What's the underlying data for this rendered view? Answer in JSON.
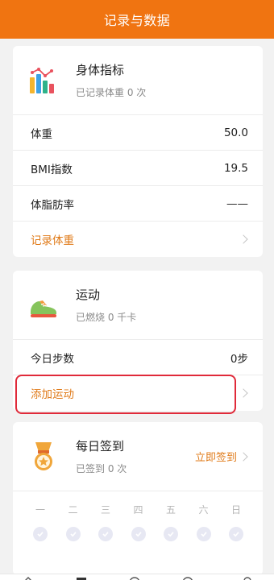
{
  "header": {
    "title": "记录与数据"
  },
  "body_card": {
    "title": "身体指标",
    "subtitle": "已记录体重 0 次",
    "rows": [
      {
        "label": "体重",
        "value": "50.0"
      },
      {
        "label": "BMI指数",
        "value": "19.5"
      },
      {
        "label": "体脂肪率",
        "value": "——"
      }
    ],
    "action_label": "记录体重"
  },
  "exercise_card": {
    "title": "运动",
    "subtitle": "已燃烧 0 千卡",
    "steps_label": "今日步数",
    "steps_value": "0步",
    "action_label": "添加运动"
  },
  "checkin_card": {
    "title": "每日签到",
    "subtitle": "已签到 0 次",
    "action_label": "立即签到",
    "weekdays": [
      "一",
      "二",
      "三",
      "四",
      "五",
      "六",
      "日"
    ]
  },
  "colors": {
    "accent": "#f07411",
    "link": "#e07b1a",
    "highlight": "#e02a3a"
  },
  "icons": {
    "body_card": "bar-chart-icon",
    "exercise_card": "sneaker-icon",
    "checkin_card": "medal-icon"
  }
}
